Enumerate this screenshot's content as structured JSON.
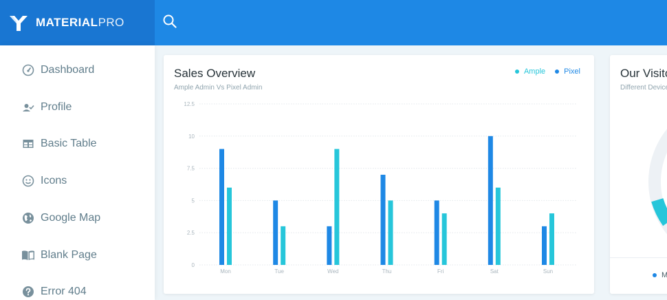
{
  "brand": {
    "name_bold": "MATERIAL",
    "name_light": "PRO"
  },
  "colors": {
    "topbar": "#1e88e5",
    "brand_bg": "#1976d2",
    "pixel": "#1e88e5",
    "ample": "#26c6da"
  },
  "sidebar": {
    "items": [
      {
        "label": "Dashboard",
        "icon": "gauge-icon"
      },
      {
        "label": "Profile",
        "icon": "user-check-icon"
      },
      {
        "label": "Basic Table",
        "icon": "table-icon"
      },
      {
        "label": "Icons",
        "icon": "smile-icon"
      },
      {
        "label": "Google Map",
        "icon": "globe-icon"
      },
      {
        "label": "Blank Page",
        "icon": "book-open-icon"
      },
      {
        "label": "Error 404",
        "icon": "help-circle-icon"
      }
    ]
  },
  "sales": {
    "title": "Sales Overview",
    "subtitle": "Ample Admin Vs Pixel Admin",
    "legend": [
      "Ample",
      "Pixel"
    ]
  },
  "visits": {
    "title": "Our Visitor",
    "subtitle": "Different Devices Used",
    "legend_label": "Mobile"
  },
  "chart_data": {
    "type": "bar",
    "categories": [
      "Mon",
      "Tue",
      "Wed",
      "Thu",
      "Fri",
      "Sat",
      "Sun"
    ],
    "series": [
      {
        "name": "Pixel",
        "color": "#1e88e5",
        "values": [
          9,
          5,
          3,
          7,
          5,
          10,
          3
        ]
      },
      {
        "name": "Ample",
        "color": "#26c6da",
        "values": [
          6,
          3,
          9,
          5,
          4,
          6,
          4
        ]
      }
    ],
    "yticks": [
      "0",
      "2.5",
      "5",
      "7.5",
      "10",
      "12.5"
    ],
    "ylim": [
      0,
      12.5
    ],
    "grid": true,
    "legend_position": "top-right"
  }
}
